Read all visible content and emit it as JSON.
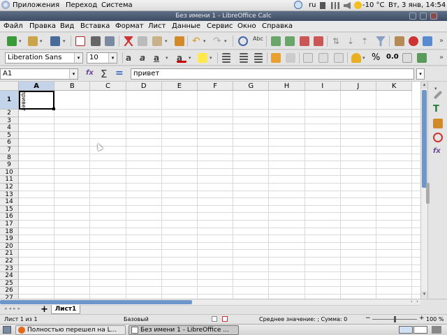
{
  "top_panel": {
    "applications": "Приложения",
    "places": "Переход",
    "system": "Система",
    "lang": "ru",
    "weather": "-10 °C",
    "clock": "Вт,  3 янв, 14:54"
  },
  "window": {
    "title": "Без имени 1 - LibreOffice Calc"
  },
  "menu": [
    "Файл",
    "Правка",
    "Вид",
    "Вставка",
    "Формат",
    "Лист",
    "Данные",
    "Сервис",
    "Окно",
    "Справка"
  ],
  "formatting": {
    "font_name": "Liberation Sans",
    "font_size": "10",
    "percent": "%",
    "decimal": "0.0"
  },
  "formula_bar": {
    "name_box": "A1",
    "content": "привет"
  },
  "sheet": {
    "columns": [
      "A",
      "B",
      "C",
      "D",
      "E",
      "F",
      "G",
      "H",
      "I",
      "J",
      "K"
    ],
    "rows": [
      "1",
      "2",
      "3",
      "4",
      "5",
      "6",
      "7",
      "8",
      "9",
      "10",
      "11",
      "12",
      "13",
      "14",
      "15",
      "16",
      "17",
      "18",
      "19",
      "20",
      "21",
      "22",
      "23",
      "24",
      "25",
      "26",
      "27"
    ],
    "cell_a1": "привет"
  },
  "tabs": {
    "sheet_tab": "Лист1"
  },
  "status": {
    "sheet_info": "Лист 1 из 1",
    "page_style": "Базовый",
    "selection_sum": "Среднее значение: ; Сумма: 0",
    "zoom": "100 %"
  },
  "taskbar": {
    "task1": "Полностью перешел на L...",
    "task2": "Без имени 1 - LibreOffice ..."
  },
  "icons": [
    "home-icon",
    "network-icon",
    "volume-icon",
    "weather-icon",
    "new-doc-icon",
    "open-icon",
    "save-icon",
    "pdf-icon",
    "print-icon",
    "preview-icon",
    "cut-icon",
    "copy-icon",
    "paste-icon",
    "clone-icon",
    "undo-icon",
    "redo-icon",
    "find-icon",
    "spellcheck-icon",
    "sort-icon",
    "filter-icon",
    "chart-icon",
    "bold-icon",
    "italic-icon",
    "underline-icon",
    "font-color-icon",
    "highlight-icon",
    "align-left-icon",
    "align-center-icon",
    "align-right-icon",
    "wrap-icon",
    "merge-icon",
    "function-wizard-icon",
    "sum-icon",
    "equals-icon",
    "properties-icon",
    "styles-icon",
    "gallery-icon",
    "navigator-icon",
    "functions-icon"
  ]
}
